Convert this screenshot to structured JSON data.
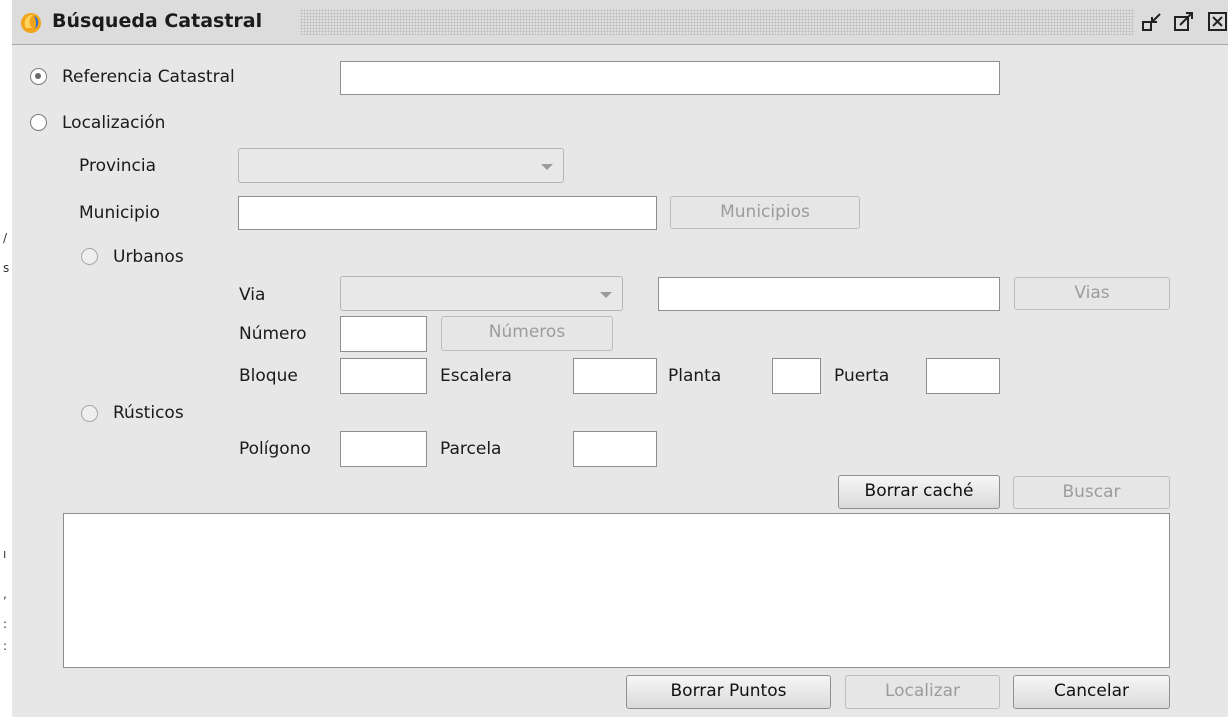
{
  "window": {
    "title": "Búsqueda Catastral",
    "controls": [
      "minimize-icon",
      "maximize-icon",
      "close-icon"
    ]
  },
  "search_mode": {
    "referencia": {
      "label": "Referencia Catastral",
      "selected": true,
      "value": ""
    },
    "localizacion": {
      "label": "Localización",
      "selected": false
    }
  },
  "location": {
    "provincia": {
      "label": "Provincia",
      "value": ""
    },
    "municipio": {
      "label": "Municipio",
      "value": "",
      "button": "Municipios"
    }
  },
  "urbanos": {
    "label": "Urbanos",
    "via": {
      "label": "Via",
      "combo_value": "",
      "text_value": "",
      "button": "Vias"
    },
    "numero": {
      "label": "Número",
      "value": "",
      "button": "Números"
    },
    "bloque": {
      "label": "Bloque",
      "value": ""
    },
    "escalera": {
      "label": "Escalera",
      "value": ""
    },
    "planta": {
      "label": "Planta",
      "value": ""
    },
    "puerta": {
      "label": "Puerta",
      "value": ""
    }
  },
  "rusticos": {
    "label": "Rústicos",
    "poligono": {
      "label": "Polígono",
      "value": ""
    },
    "parcela": {
      "label": "Parcela",
      "value": ""
    }
  },
  "actions": {
    "borrar_cache": "Borrar caché",
    "buscar": "Buscar",
    "borrar_puntos": "Borrar Puntos",
    "localizar": "Localizar",
    "cancelar": "Cancelar"
  },
  "results": []
}
